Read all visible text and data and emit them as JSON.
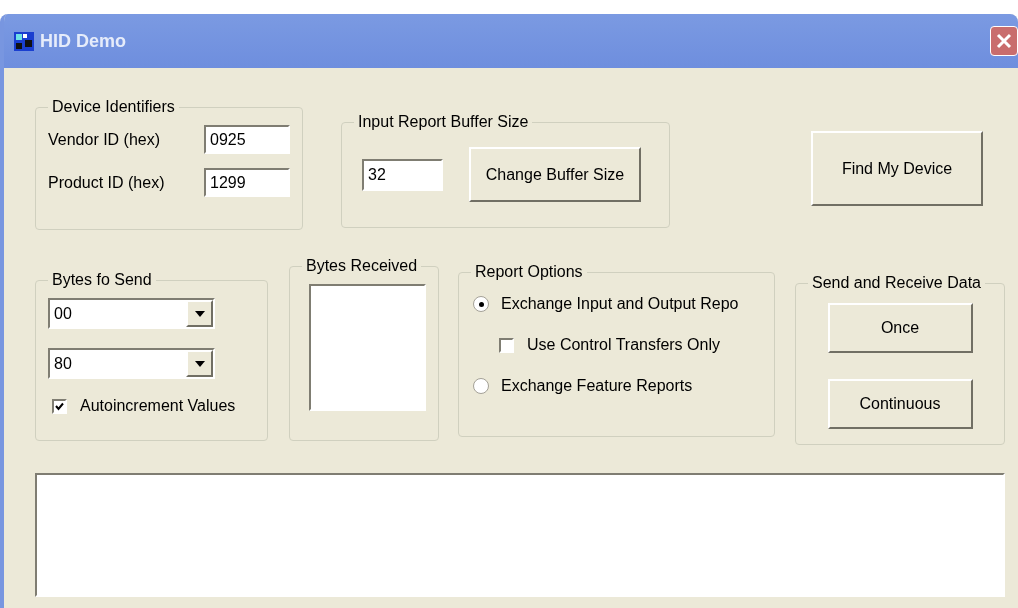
{
  "window": {
    "title": "HID Demo"
  },
  "device_identifiers": {
    "title": "Device Identifiers",
    "fields": [
      {
        "label": "Vendor ID (hex)",
        "value": "0925"
      },
      {
        "label": "Product ID (hex)",
        "value": "1299"
      }
    ]
  },
  "input_report_buffer": {
    "title": "Input Report Buffer Size",
    "value": "32",
    "button": "Change Buffer Size"
  },
  "find_button": "Find My Device",
  "bytes_to_send": {
    "title": "Bytes fo Send",
    "dropdowns": [
      {
        "value": "00"
      },
      {
        "value": "80"
      }
    ],
    "autoincrement": {
      "label": "Autoincrement Values",
      "checked": true
    }
  },
  "bytes_received": {
    "title": "Bytes Received"
  },
  "report_options": {
    "title": "Report Options",
    "options": [
      {
        "kind": "radio",
        "label": "Exchange Input and Output Repo",
        "selected": true
      },
      {
        "kind": "checkbox",
        "label": "Use Control Transfers Only",
        "checked": false
      },
      {
        "kind": "radio",
        "label": "Exchange Feature Reports",
        "selected": false
      }
    ]
  },
  "send_receive": {
    "title": "Send and Receive Data",
    "buttons": [
      "Once",
      "Continuous"
    ]
  }
}
